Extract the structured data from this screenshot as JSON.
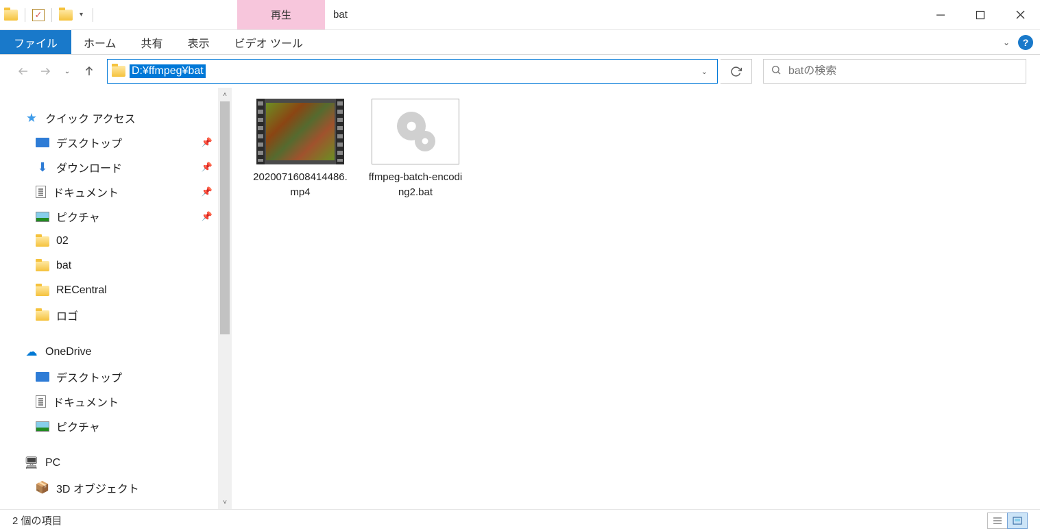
{
  "titlebar": {
    "context_tab": "再生",
    "title": "bat"
  },
  "ribbon": {
    "file": "ファイル",
    "home": "ホーム",
    "share": "共有",
    "view": "表示",
    "video_tools": "ビデオ ツール"
  },
  "address": {
    "path": "D:¥ffmpeg¥bat"
  },
  "search": {
    "placeholder": "batの検索"
  },
  "sidebar": {
    "quick_access": "クイック アクセス",
    "desktop": "デスクトップ",
    "downloads": "ダウンロード",
    "documents": "ドキュメント",
    "pictures": "ピクチャ",
    "folder_02": "02",
    "folder_bat": "bat",
    "folder_recentral": "RECentral",
    "folder_logo": "ロゴ",
    "onedrive": "OneDrive",
    "od_desktop": "デスクトップ",
    "od_documents": "ドキュメント",
    "od_pictures": "ピクチャ",
    "pc": "PC",
    "objects3d": "3D オブジェクト"
  },
  "files": {
    "item1": "2020071608414486.mp4",
    "item2": "ffmpeg-batch-encoding2.bat"
  },
  "status": {
    "count": "2 個の項目"
  }
}
